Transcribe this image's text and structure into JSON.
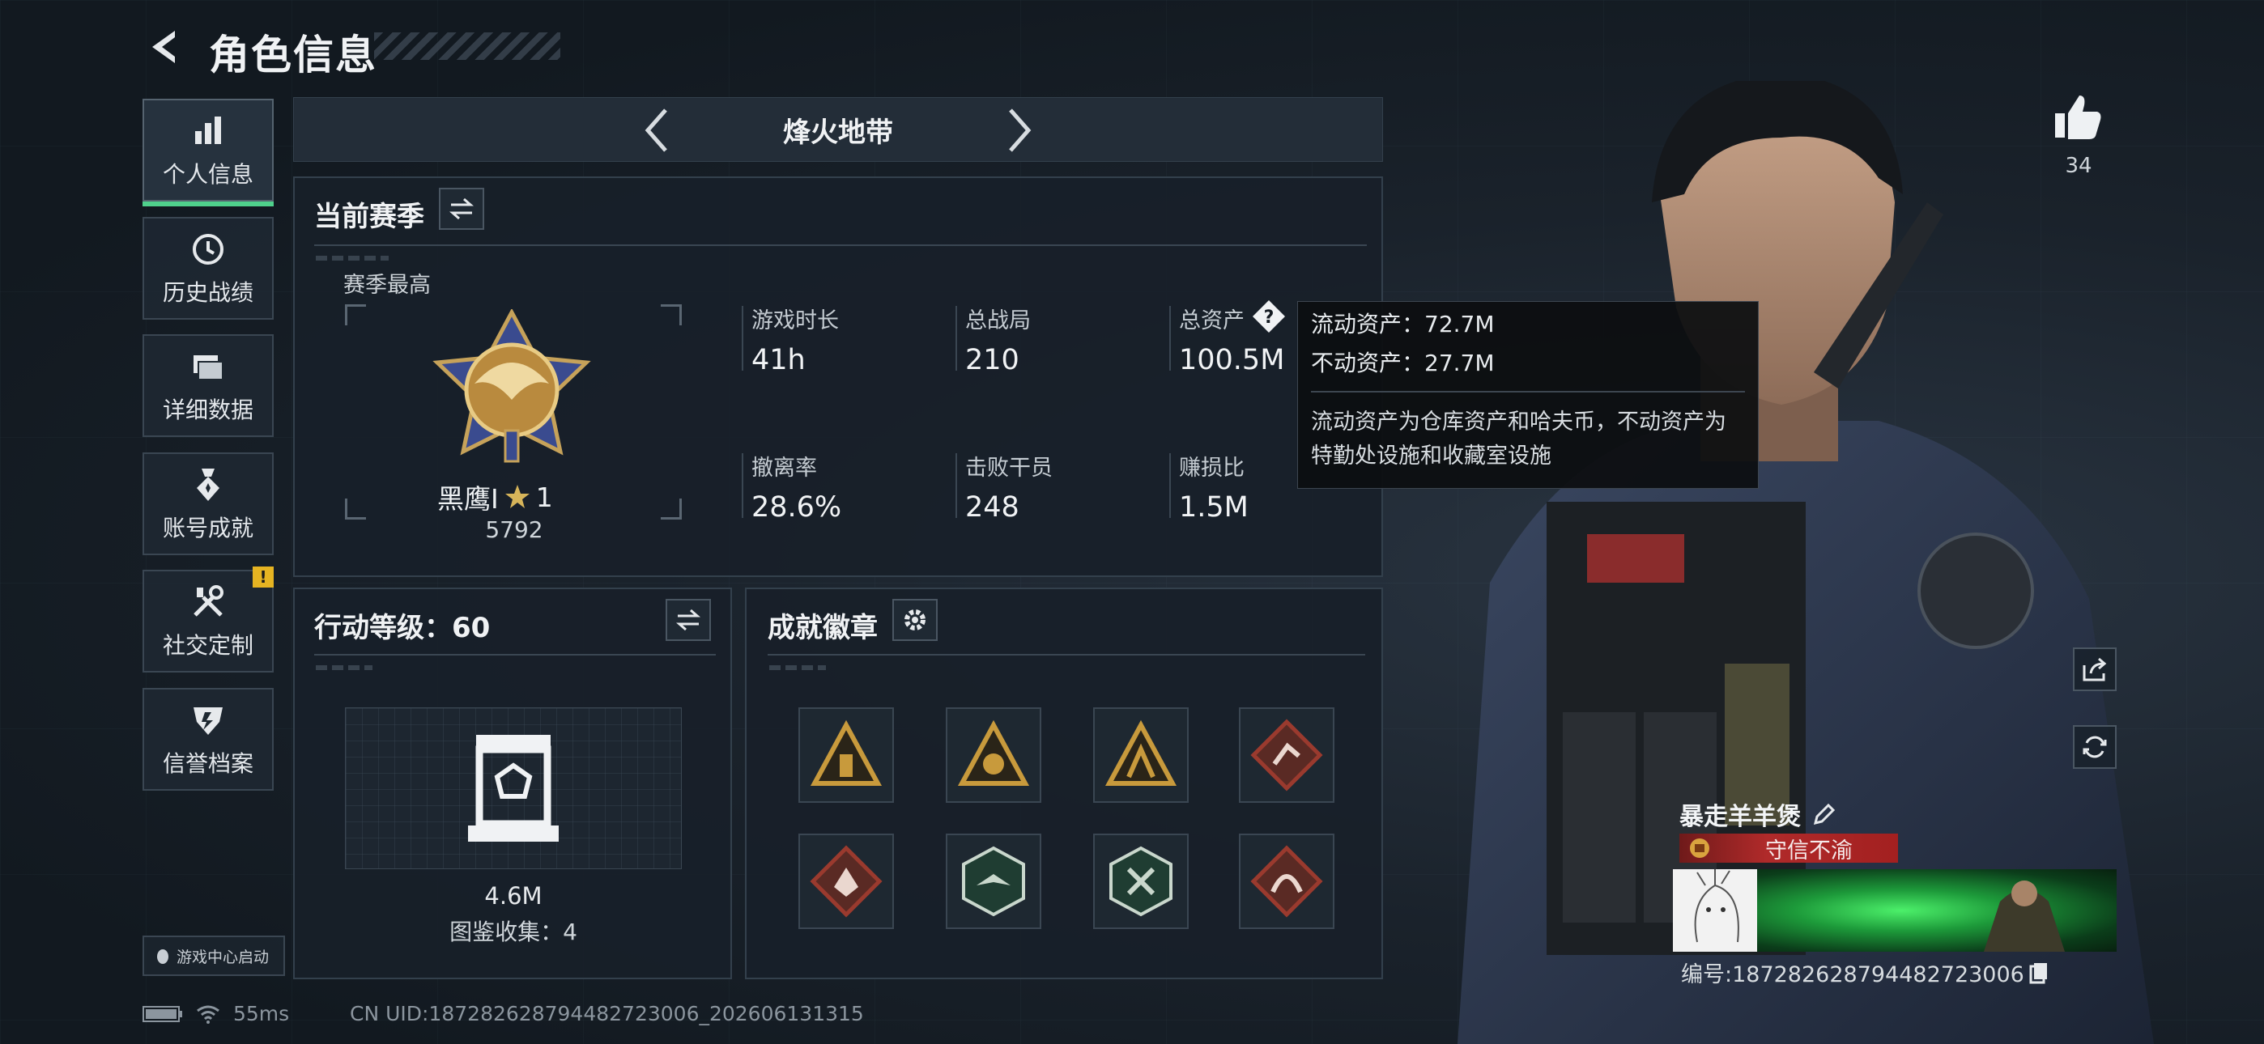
{
  "header": {
    "title": "角色信息",
    "back_icon": "back-arrow-icon"
  },
  "sidebar": {
    "items": [
      {
        "label": "个人信息",
        "icon": "bar-chart-icon",
        "active": true
      },
      {
        "label": "历史战绩",
        "icon": "history-clock-icon",
        "active": false
      },
      {
        "label": "详细数据",
        "icon": "folder-stack-icon",
        "active": false
      },
      {
        "label": "账号成就",
        "icon": "medal-icon",
        "active": false
      },
      {
        "label": "社交定制",
        "icon": "tools-icon",
        "active": false,
        "badge": "!"
      },
      {
        "label": "信誉档案",
        "icon": "shield-emblem-icon",
        "active": false
      }
    ],
    "game_center": "游戏中心启动"
  },
  "mode_bar": {
    "title": "烽火地带"
  },
  "season": {
    "title": "当前赛季",
    "best_label": "赛季最高",
    "rank_name": "黑鹰I",
    "rank_stars": "1",
    "rank_score": "5792",
    "stats": [
      {
        "label": "游戏时长",
        "value": "41h"
      },
      {
        "label": "总战局",
        "value": "210"
      },
      {
        "label": "总资产",
        "value": "100.5M"
      },
      {
        "label": "撤离率",
        "value": "28.6%"
      },
      {
        "label": "击败干员",
        "value": "248"
      },
      {
        "label": "赚损比",
        "value": "1.5M"
      }
    ]
  },
  "tooltip": {
    "liquid": "流动资产：72.7M",
    "fixed": "不动资产：27.7M",
    "desc": "流动资产为仓库资产和哈夫币，不动资产为特勤处设施和收藏室设施"
  },
  "level": {
    "title": "行动等级：60",
    "collect_value": "4.6M",
    "collect_count": "图鉴收集：4"
  },
  "badges": {
    "title": "成就徽章",
    "items": [
      {
        "name": "triangle-gold-badge",
        "color": "#c89a3c"
      },
      {
        "name": "triangle-hand-badge",
        "color": "#c89a3c"
      },
      {
        "name": "triangle-figure-badge",
        "color": "#c89a3c"
      },
      {
        "name": "diamond-runner-badge",
        "color": "#9a3a2e"
      },
      {
        "name": "diamond-wolf-badge",
        "color": "#9a3a2e"
      },
      {
        "name": "hex-bird-badge",
        "color": "#2f6e54"
      },
      {
        "name": "hex-tools-badge",
        "color": "#2f6e54"
      },
      {
        "name": "diamond-dragon-badge",
        "color": "#9a3a2e"
      }
    ]
  },
  "profile": {
    "likes": "34",
    "name": "暴走羊羊煲",
    "title_tag": "守信不渝",
    "player_id": "编号:187282628794482723006"
  },
  "status": {
    "ping": "55ms",
    "uid": "CN UID:187282628794482723006_202606131315"
  },
  "colors": {
    "accent_green": "#4fd18c",
    "warning": "#e6b422",
    "title_red": "#b02a2a"
  }
}
